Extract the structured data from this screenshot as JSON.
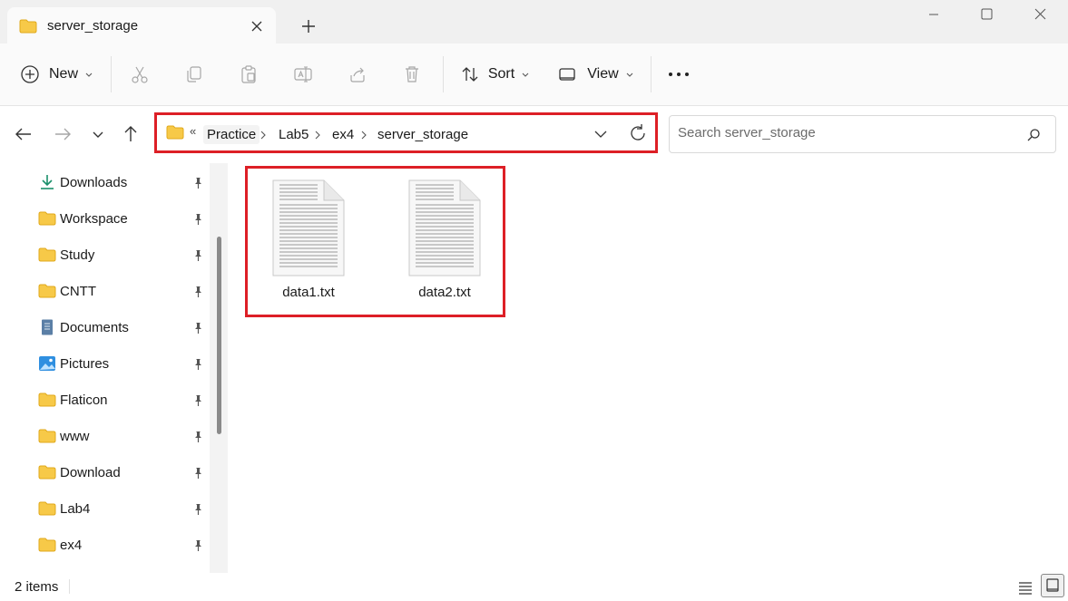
{
  "window": {
    "tab_title": "server_storage"
  },
  "toolbar": {
    "new_label": "New",
    "sort_label": "Sort",
    "view_label": "View"
  },
  "address": {
    "overflow_marker": "«",
    "crumbs": [
      "Practice",
      "Lab5",
      "ex4",
      "server_storage"
    ]
  },
  "search": {
    "placeholder": "Search server_storage"
  },
  "sidebar": {
    "items": [
      {
        "label": "Downloads",
        "icon": "download-icon"
      },
      {
        "label": "Workspace",
        "icon": "folder-icon"
      },
      {
        "label": "Study",
        "icon": "folder-icon"
      },
      {
        "label": "CNTT",
        "icon": "folder-icon"
      },
      {
        "label": "Documents",
        "icon": "documents-icon"
      },
      {
        "label": "Pictures",
        "icon": "pictures-icon"
      },
      {
        "label": "Flaticon",
        "icon": "folder-icon"
      },
      {
        "label": "www",
        "icon": "folder-icon"
      },
      {
        "label": "Download",
        "icon": "folder-icon"
      },
      {
        "label": "Lab4",
        "icon": "folder-icon"
      },
      {
        "label": "ex4",
        "icon": "folder-icon"
      }
    ]
  },
  "files": [
    {
      "name": "data1.txt"
    },
    {
      "name": "data2.txt"
    }
  ],
  "status": {
    "item_count": "2 items"
  },
  "colors": {
    "highlight_border": "#dd1f26",
    "folder_yellow": "#f7c948",
    "accent": "#0067c0"
  }
}
